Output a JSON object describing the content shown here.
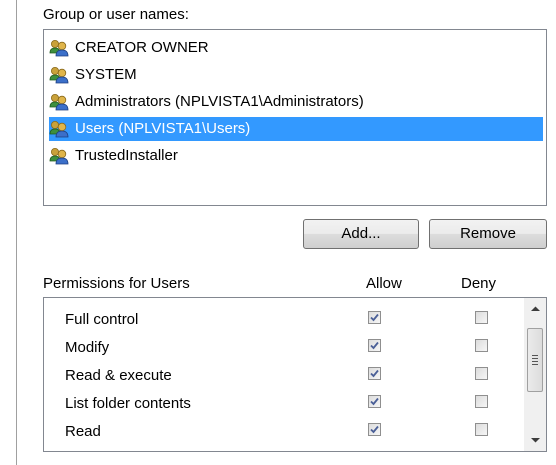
{
  "group_label": "Group or user names:",
  "users": [
    {
      "name": "CREATOR OWNER",
      "selected": false
    },
    {
      "name": "SYSTEM",
      "selected": false
    },
    {
      "name": "Administrators (NPLVISTA1\\Administrators)",
      "selected": false
    },
    {
      "name": "Users (NPLVISTA1\\Users)",
      "selected": true
    },
    {
      "name": "TrustedInstaller",
      "selected": false
    }
  ],
  "buttons": {
    "add": "Add...",
    "remove": "Remove"
  },
  "permissions_header": {
    "title": "Permissions for Users",
    "allow": "Allow",
    "deny": "Deny"
  },
  "permissions": [
    {
      "name": "Full control",
      "allow": true,
      "deny": false
    },
    {
      "name": "Modify",
      "allow": true,
      "deny": false
    },
    {
      "name": "Read & execute",
      "allow": true,
      "deny": false
    },
    {
      "name": "List folder contents",
      "allow": true,
      "deny": false
    },
    {
      "name": "Read",
      "allow": true,
      "deny": false
    }
  ],
  "icons": {
    "user": "user-group-icon",
    "check": "checkmark-icon",
    "scroll_up": "chevron-up-icon",
    "scroll_down": "chevron-down-icon"
  },
  "colors": {
    "selection": "#3399ff",
    "check": "#4a5f97"
  }
}
